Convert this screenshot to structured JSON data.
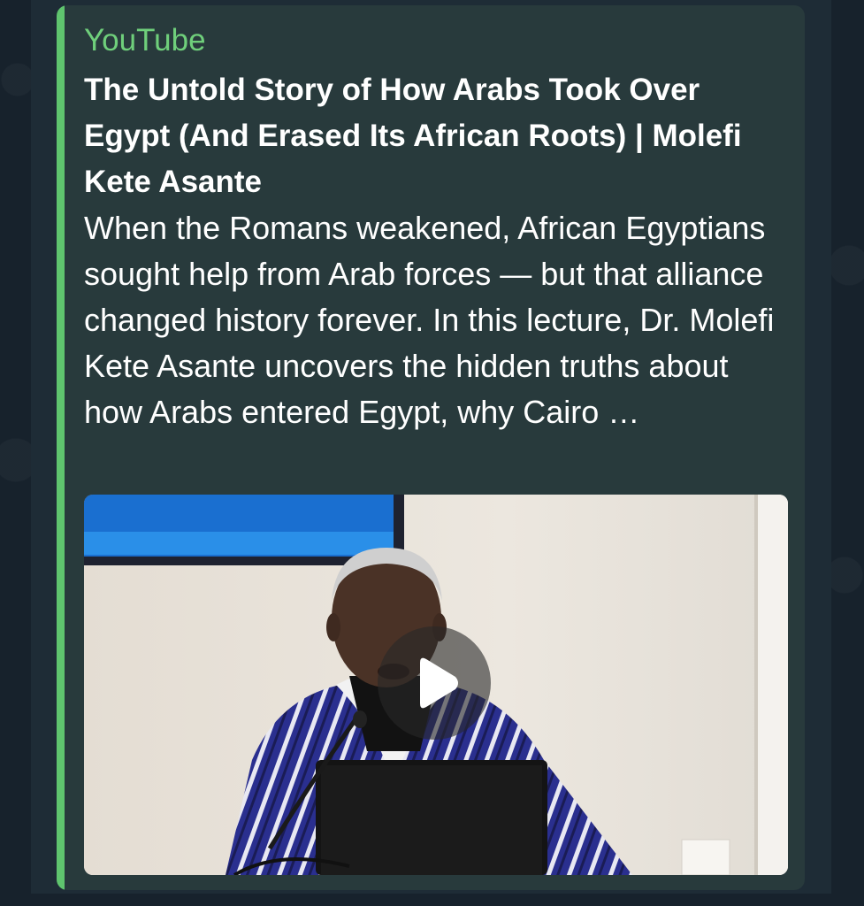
{
  "link_preview": {
    "site_name": "YouTube",
    "title": "The Untold Story of How Arabs Took Over Egypt (And Erased Its African Roots) | Molefi Kete Asante",
    "description": "When the Romans weakened, African Egyptians sought help from Arab forces — but that alliance changed history forever. In this lecture, Dr. Molefi Kete Asante uncovers the hidden truths about how Arabs entered Egypt, why Cairo …",
    "accent_color": "#5fc46e",
    "thumbnail": {
      "icon": "play-icon"
    }
  }
}
